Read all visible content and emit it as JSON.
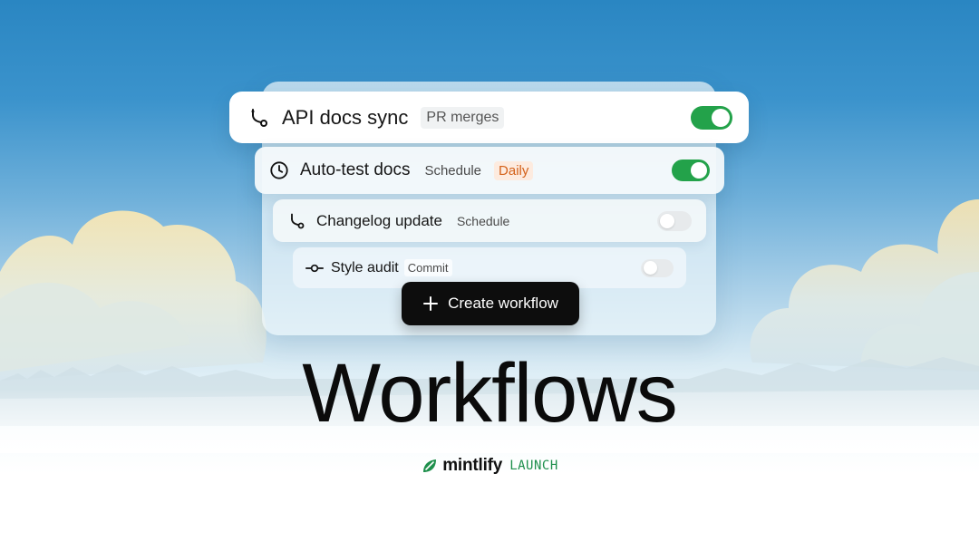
{
  "workflows": [
    {
      "title": "API docs sync",
      "icon": "git-branch-icon",
      "tags": [
        "PR merges"
      ],
      "enabled": true
    },
    {
      "title": "Auto-test docs",
      "icon": "clock-icon",
      "tags": [
        "Schedule"
      ],
      "frequency": "Daily",
      "enabled": true
    },
    {
      "title": "Changelog update",
      "icon": "git-branch-icon",
      "tags": [
        "Schedule"
      ],
      "enabled": false
    },
    {
      "title": "Style audit",
      "icon": "git-commit-icon",
      "tags": [
        "Commit"
      ],
      "enabled": false
    }
  ],
  "create_button": {
    "label": "Create workflow",
    "icon": "plus-icon"
  },
  "headline": "Workflows",
  "brand": {
    "name": "mintlify",
    "tagline": "LAUNCH",
    "logo_icon": "mintlify-leaf-icon"
  },
  "colors": {
    "toggle_on": "#23a24a",
    "toggle_off": "#e7eaec",
    "daily_badge_bg": "#fdebdf",
    "daily_badge_text": "#d4621a",
    "brand_green": "#1e8f4c",
    "button_bg": "#0d0d0d"
  }
}
